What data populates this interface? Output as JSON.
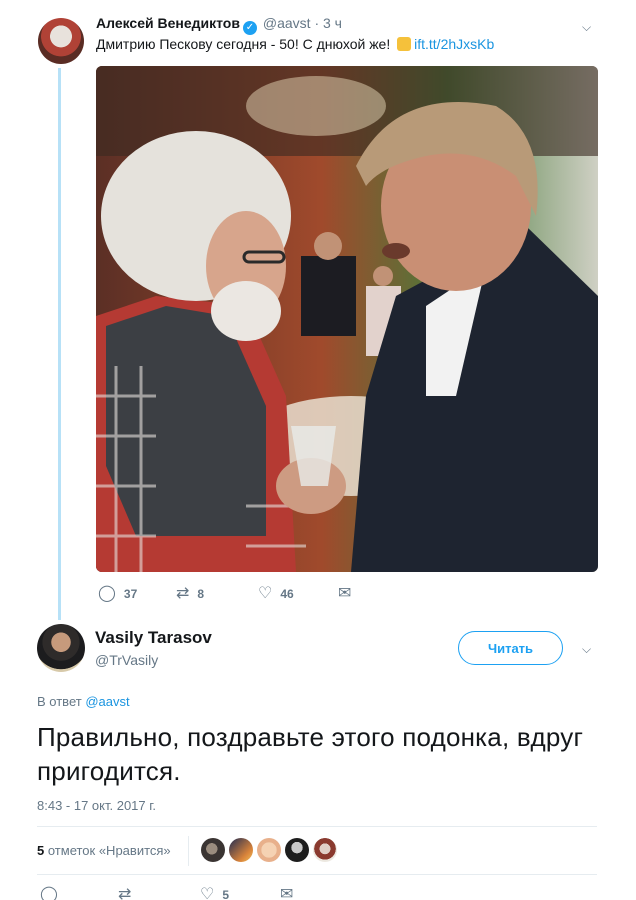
{
  "quoted_tweet": {
    "author_name": "Алексей Венедиктов",
    "handle": "@aavst",
    "separator": "·",
    "time": "3 ч",
    "text_before_emoji": "Дмитрию Пескову сегодня - 50! С днюхой же! ",
    "link": "ift.tt/2hJxsKb",
    "replies": "37",
    "retweets": "8",
    "likes": "46"
  },
  "main_tweet": {
    "author_name": "Vasily Tarasov",
    "handle": "@TrVasily",
    "follow_label": "Читать",
    "reply_prefix": "В ответ",
    "reply_handle": "@aavst",
    "text": "Правильно, поздравьте этого подонка, вдруг пригодится.",
    "timestamp": "8:43 - 17 окт. 2017 г.",
    "likes_count": "5",
    "likes_label": "отметок «Нравится»",
    "action_likes": "5"
  },
  "icons": {
    "verified": "verified-badge-icon",
    "reply": "reply-icon",
    "retweet": "retweet-icon",
    "like": "heart-icon",
    "dm": "envelope-icon",
    "more": "chevron-down-icon"
  },
  "colors": {
    "accent": "#1da1f2",
    "link": "#1b95e0",
    "muted": "#657786",
    "thread_line": "#b7e1f7"
  }
}
